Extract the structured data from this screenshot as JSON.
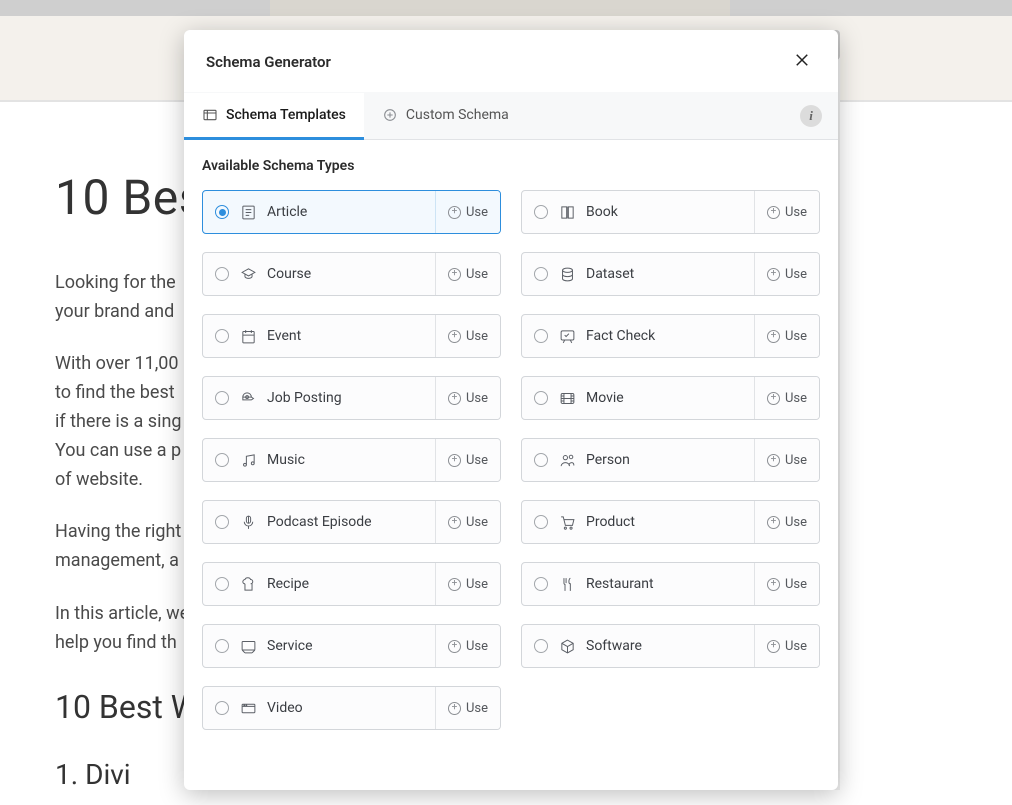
{
  "background": {
    "h1": "10 Bes",
    "p1": "Looking for the ",
    "p1b": "your brand and ",
    "p2a": "With over 11,00",
    "p2b": "to find the best ",
    "p2c": "if there is a sing",
    "p2d": "You can use a p",
    "p2e": "of website.",
    "p3a": "Having the right",
    "p3b": "management, a",
    "p4a": "In this article, we",
    "p4b": "help you find th",
    "h2": "10 Best W",
    "h3": "1. Divi"
  },
  "modal": {
    "title": "Schema Generator",
    "tabs": {
      "templates": "Schema Templates",
      "custom": "Custom Schema"
    },
    "section_title": "Available Schema Types",
    "use_label": "Use",
    "schemas": [
      {
        "key": "article",
        "label": "Article",
        "icon": "article",
        "selected": true
      },
      {
        "key": "book",
        "label": "Book",
        "icon": "book",
        "selected": false
      },
      {
        "key": "course",
        "label": "Course",
        "icon": "course",
        "selected": false
      },
      {
        "key": "dataset",
        "label": "Dataset",
        "icon": "dataset",
        "selected": false
      },
      {
        "key": "event",
        "label": "Event",
        "icon": "event",
        "selected": false
      },
      {
        "key": "factcheck",
        "label": "Fact Check",
        "icon": "factcheck",
        "selected": false
      },
      {
        "key": "job",
        "label": "Job Posting",
        "icon": "job",
        "selected": false
      },
      {
        "key": "movie",
        "label": "Movie",
        "icon": "movie",
        "selected": false
      },
      {
        "key": "music",
        "label": "Music",
        "icon": "music",
        "selected": false
      },
      {
        "key": "person",
        "label": "Person",
        "icon": "person",
        "selected": false
      },
      {
        "key": "podcast",
        "label": "Podcast Episode",
        "icon": "podcast",
        "selected": false
      },
      {
        "key": "product",
        "label": "Product",
        "icon": "product",
        "selected": false
      },
      {
        "key": "recipe",
        "label": "Recipe",
        "icon": "recipe",
        "selected": false
      },
      {
        "key": "restaurant",
        "label": "Restaurant",
        "icon": "restaurant",
        "selected": false
      },
      {
        "key": "service",
        "label": "Service",
        "icon": "service",
        "selected": false
      },
      {
        "key": "software",
        "label": "Software",
        "icon": "software",
        "selected": false
      },
      {
        "key": "video",
        "label": "Video",
        "icon": "video",
        "selected": false
      }
    ]
  }
}
